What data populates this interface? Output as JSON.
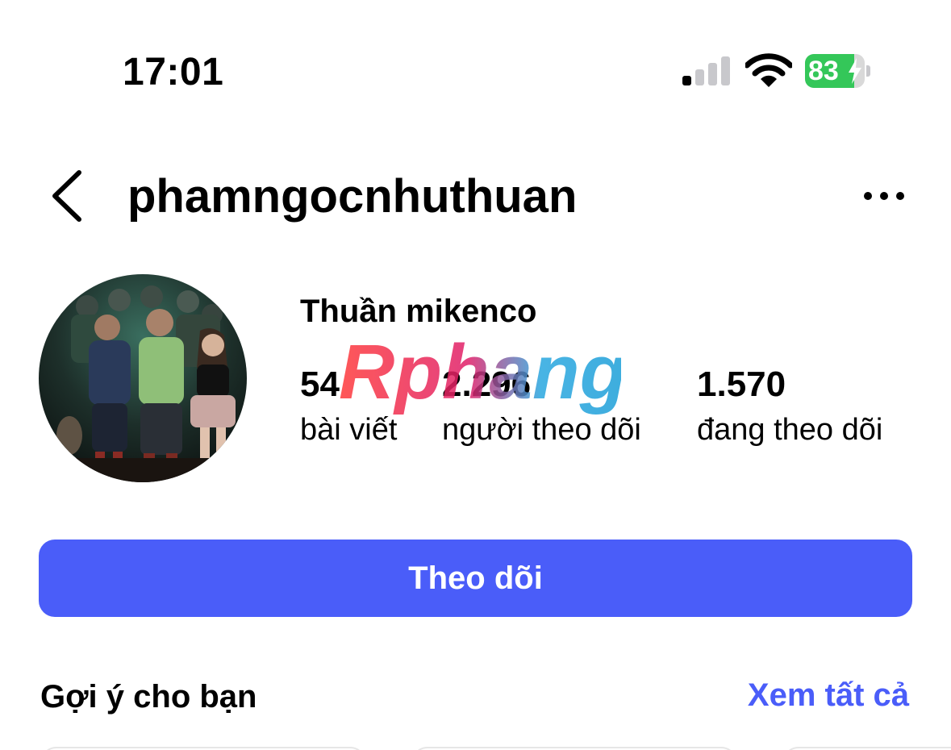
{
  "status_bar": {
    "time": "17:01",
    "signal_bars_active": 1,
    "signal_bars_total": 4,
    "battery_percent": "83",
    "battery_level": 0.83,
    "charging": true
  },
  "header": {
    "username": "phamngocnhuthuan",
    "back_icon": "chevron-left-icon",
    "more_icon": "more-horizontal-icon"
  },
  "profile": {
    "display_name": "Thuần mikenco",
    "stats": [
      {
        "value": "54",
        "label": "bài viết"
      },
      {
        "value": "2.296",
        "label": "người theo dõi"
      },
      {
        "value": "1.570",
        "label": "đang theo dõi"
      }
    ],
    "watermark": "Rphang"
  },
  "actions": {
    "follow_label": "Theo dõi"
  },
  "suggestions": {
    "title": "Gợi ý cho bạn",
    "see_all_label": "Xem tất cả"
  },
  "colors": {
    "accent": "#4a5df9",
    "battery_green": "#34c759",
    "text": "#000000",
    "background": "#ffffff"
  }
}
